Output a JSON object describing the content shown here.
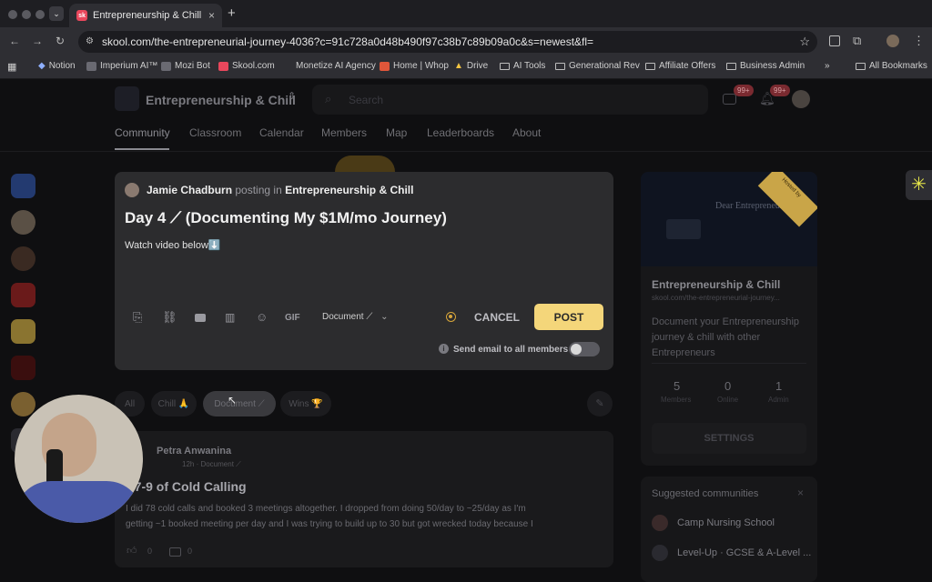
{
  "browser": {
    "tab_title": "Entrepreneurship & Chill · Do",
    "favicon_text": "sk",
    "url": "skool.com/the-entrepreneurial-journey-4036?c=91c728a0d48b490f97c38b7c89b09a0c&s=newest&fl=",
    "bookmarks": [
      "Notion",
      "Imperium AI™",
      "Mozi Bot",
      "Skool.com",
      "Monetize AI Agency",
      "Home | Whop",
      "Drive",
      "AI Tools",
      "Generational Rev",
      "Affiliate Offers",
      "Business Admin"
    ],
    "all_bookmarks": "All Bookmarks"
  },
  "header": {
    "community_name": "Entrepreneurship & Chill",
    "search_placeholder": "Search",
    "chat_badge": "99+",
    "notif_badge": "99+"
  },
  "nav_tabs": [
    "Community",
    "Classroom",
    "Calendar",
    "Members",
    "Map",
    "Leaderboards",
    "About"
  ],
  "composer": {
    "author": "Jamie Chadburn",
    "posting_in": "posting in",
    "community": "Entrepreneurship & Chill",
    "title": "Day 4 ⟋ (Documenting My $1M/mo Journey)",
    "body": "Watch video below⬇️",
    "gif": "GIF",
    "category": "Document ⟋",
    "cancel": "CANCEL",
    "post": "POST",
    "email_label": "Send email to all members"
  },
  "filters": [
    "All",
    "Chill 🙏",
    "Document ⟋",
    "Wins 🏆"
  ],
  "feed_post": {
    "author": "Petra Anwanina",
    "meta": "12h · Document ⟋",
    "title": "y 7-9 of Cold Calling",
    "excerpt_line1": "I did 78 cold calls and booked 3 meetings altogether. I dropped from doing 50/day to ~25/day as I'm",
    "excerpt_line2": "getting ~1 booked meeting per day and I was trying to build up to 30 but got wrecked today because I",
    "likes": "0",
    "comments": "0"
  },
  "about_card": {
    "banner_text": "Dear Entrepreneur",
    "ribbon": "Hosted by",
    "name": "Entrepreneurship & Chill",
    "url": "skool.com/the-entrepreneurial-journey...",
    "description": "Document your Entrepreneurship journey & chill with other Entrepreneurs",
    "stats": [
      {
        "value": "5",
        "label": "Members"
      },
      {
        "value": "0",
        "label": "Online"
      },
      {
        "value": "1",
        "label": "Admin"
      }
    ],
    "settings": "SETTINGS"
  },
  "suggested": {
    "title": "Suggested communities",
    "items": [
      "Camp Nursing School",
      "Level-Up · GCSE & A-Level ..."
    ]
  },
  "colors": {
    "accent_yellow": "#f4d67a",
    "badge_red": "#e0434f",
    "background": "#0f0f11",
    "card": "#1a1a1c"
  }
}
